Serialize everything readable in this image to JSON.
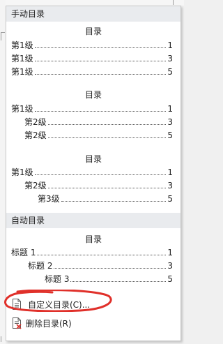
{
  "manual_toc": {
    "header": "手动目录",
    "styles": [
      {
        "title": "目录",
        "rows": [
          {
            "label": "第1级",
            "page": "1"
          },
          {
            "label": "第1级",
            "page": "3"
          },
          {
            "label": "第1级",
            "page": "5"
          }
        ]
      },
      {
        "title": "目录",
        "rows": [
          {
            "label": "第1级",
            "page": "1"
          },
          {
            "label": "第2级",
            "page": "3"
          },
          {
            "label": "第2级",
            "page": "5"
          }
        ]
      },
      {
        "title": "目录",
        "rows": [
          {
            "label": "第1级",
            "page": "1"
          },
          {
            "label": "第2级",
            "page": "3"
          },
          {
            "label": "第3级",
            "page": "5"
          }
        ]
      }
    ]
  },
  "auto_toc": {
    "header": "自动目录",
    "style": {
      "title": "目录",
      "rows": [
        {
          "label": "标题 1",
          "page": "1"
        },
        {
          "label": "标题 2",
          "page": "3"
        },
        {
          "label": "标题 3",
          "page": "5"
        }
      ]
    }
  },
  "commands": {
    "custom_label": "自定义目录(C)...",
    "delete_label": "删除目录(R)"
  },
  "icons": {
    "custom": "document-icon",
    "delete": "document-delete-icon"
  },
  "colors": {
    "annotation": "#e0302a",
    "header_bg": "#e9ebee"
  }
}
